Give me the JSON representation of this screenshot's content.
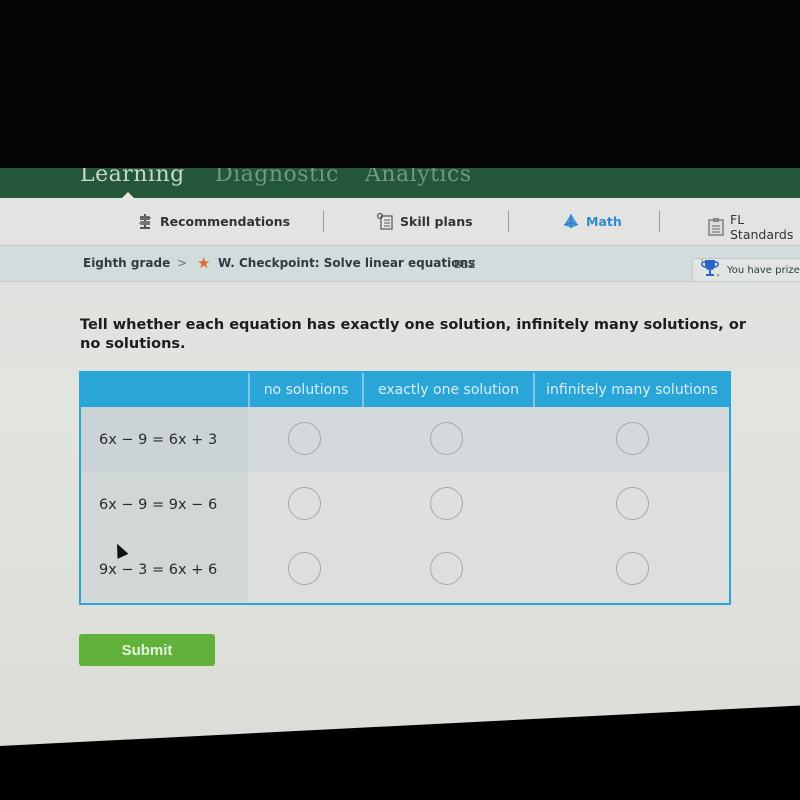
{
  "topnav": {
    "items": [
      {
        "label": "Learning",
        "active": true
      },
      {
        "label": "Diagnostic",
        "active": false
      },
      {
        "label": "Analytics",
        "active": false
      }
    ]
  },
  "subnav": {
    "items": [
      {
        "label": "Recommendations",
        "icon": "signpost-icon",
        "active": false
      },
      {
        "label": "Skill plans",
        "icon": "skill-plans-icon",
        "active": false
      },
      {
        "label": "Math",
        "icon": "pyramid-icon",
        "active": true
      },
      {
        "label": "FL Standards",
        "icon": "clipboard-icon",
        "active": false
      }
    ]
  },
  "breadcrumb": {
    "grade": "Eighth grade",
    "separator": ">",
    "skill": "W. Checkpoint: Solve linear equations",
    "code": "BBZ"
  },
  "prize": {
    "text": "You have prizes"
  },
  "question": {
    "prompt": "Tell whether each equation has exactly one solution, infinitely many solutions, or no solutions."
  },
  "grid": {
    "columns": [
      "no solutions",
      "exactly one solution",
      "infinitely many solutions"
    ],
    "rows": [
      {
        "equation": "6x − 9 = 6x + 3",
        "selected": null
      },
      {
        "equation": "6x − 9 = 9x − 6",
        "selected": null
      },
      {
        "equation": "9x − 3 = 6x + 6",
        "selected": null
      }
    ]
  },
  "submit": {
    "label": "Submit"
  },
  "colors": {
    "topnav_bg": "#24563a",
    "accent_blue": "#2aa5d8",
    "active_tab": "#2c8bd0",
    "submit_green": "#62b13a",
    "star_orange": "#e06a2c",
    "trophy_blue": "#2a64c4"
  }
}
